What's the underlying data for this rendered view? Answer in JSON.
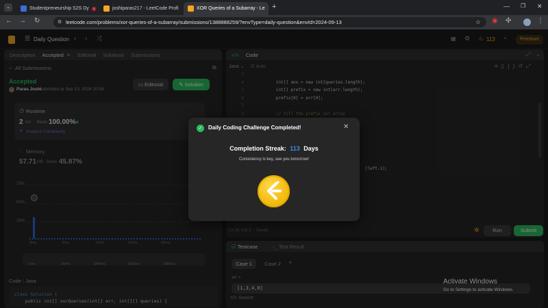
{
  "browser": {
    "tabs": [
      {
        "title": "Studentpreneurship S2S Dy",
        "color": "#3b6fd8"
      },
      {
        "title": "joshiparas217 - LeetCode Profi",
        "color": "#f5a623"
      },
      {
        "title": "XOR Queries of a Subarray - Le",
        "color": "#f5a623"
      }
    ],
    "url": "leetcode.com/problems/xor-queries-of-a-subarray/submissions/1388888259/?envType=daily-question&envId=2024-09-13",
    "new_tab": "+"
  },
  "header": {
    "daily_question": "Daily Question",
    "streak_count": "113",
    "premium": "Premium"
  },
  "left": {
    "tabs": [
      "Description",
      "Accepted",
      "Editorial",
      "Solutions",
      "Submissions"
    ],
    "all_submissions": "All Submissions",
    "status": "Accepted",
    "user": "Paras Joshi",
    "submitted_at": "submitted at Sep 13, 2024 20:56",
    "editorial_btn": "Editorial",
    "solution_btn": "Solution",
    "runtime_label": "Runtime",
    "runtime_value": "2",
    "runtime_unit": "ms",
    "beats_label": "Beats",
    "runtime_beats": "100.00%",
    "analyze": "Analyze Complexity",
    "memory_label": "Memory",
    "memory_value": "57.71",
    "memory_unit": "MB",
    "memory_beats": "45.87%",
    "y_ticks": [
      "75%",
      "50%",
      "25%"
    ],
    "x_axis_label": "2ms",
    "range_ticks": [
      "1ms",
      "30ms",
      "344ms",
      "509ms",
      "689ms"
    ],
    "code_tabs": [
      "Code",
      "Java"
    ],
    "code_line1": "class Solution {",
    "code_line2": "    public int[] xorQueries(int[] arr, int[][] queries) {"
  },
  "chart_data": {
    "type": "bar",
    "title": "",
    "x": [
      "2ms"
    ],
    "values": [
      30
    ],
    "ylabel": "",
    "y_ticks": [
      "25%",
      "50%",
      "75%"
    ],
    "ylim": [
      0,
      75
    ]
  },
  "editor": {
    "title": "Code",
    "language": "Java",
    "auto": "Auto",
    "lines": [
      {
        "n": "3",
        "code": ""
      },
      {
        "n": "4",
        "code": "        int[] ans = new int[queries.length];"
      },
      {
        "n": "5",
        "code": "        int[] prefix = new int[arr.length];"
      },
      {
        "n": "6",
        "code": "        prefix[0] = arr[0];"
      },
      {
        "n": "7",
        "code": ""
      },
      {
        "n": "8",
        "code": "        // fill the prefix xor array"
      },
      {
        "n": "9",
        "code": "        for(int i=1; i<arr.length; i++){"
      },
      {
        "n": "10",
        "code": ""
      },
      {
        "n": "11",
        "code": ""
      },
      {
        "n": "12",
        "code": ""
      },
      {
        "n": "13",
        "code": ""
      },
      {
        "n": "14",
        "code": ""
      },
      {
        "n": "15",
        "code": "                                            [left-1];"
      },
      {
        "n": "16",
        "code": ""
      },
      {
        "n": "17",
        "code": ""
      },
      {
        "n": "18",
        "code": ""
      },
      {
        "n": "19",
        "code": ""
      }
    ],
    "status": "Ln 24, Col 2",
    "saved": "Saved",
    "run": "Run",
    "submit": "Submit"
  },
  "testcase": {
    "tab_testcase": "Testcase",
    "tab_result": "Test Result",
    "case1": "Case 1",
    "case2": "Case 2",
    "add": "+",
    "arr_label": "arr =",
    "arr_value": "[1,3,4,8]",
    "source": "Source"
  },
  "modal": {
    "title": "Daily Coding Challenge Completed!",
    "streak_label": "Completion Streak:",
    "streak_value": "113",
    "streak_unit": "Days",
    "message": "Consistency is key, see you tomorrow!",
    "close": "✕"
  },
  "watermark": {
    "line1": "Activate Windows",
    "line2": "Go to Settings to activate Windows."
  },
  "colors": {
    "accent_green": "#2cbb5d",
    "accent_orange": "#ffa116",
    "streak_blue": "#3b8eea"
  }
}
